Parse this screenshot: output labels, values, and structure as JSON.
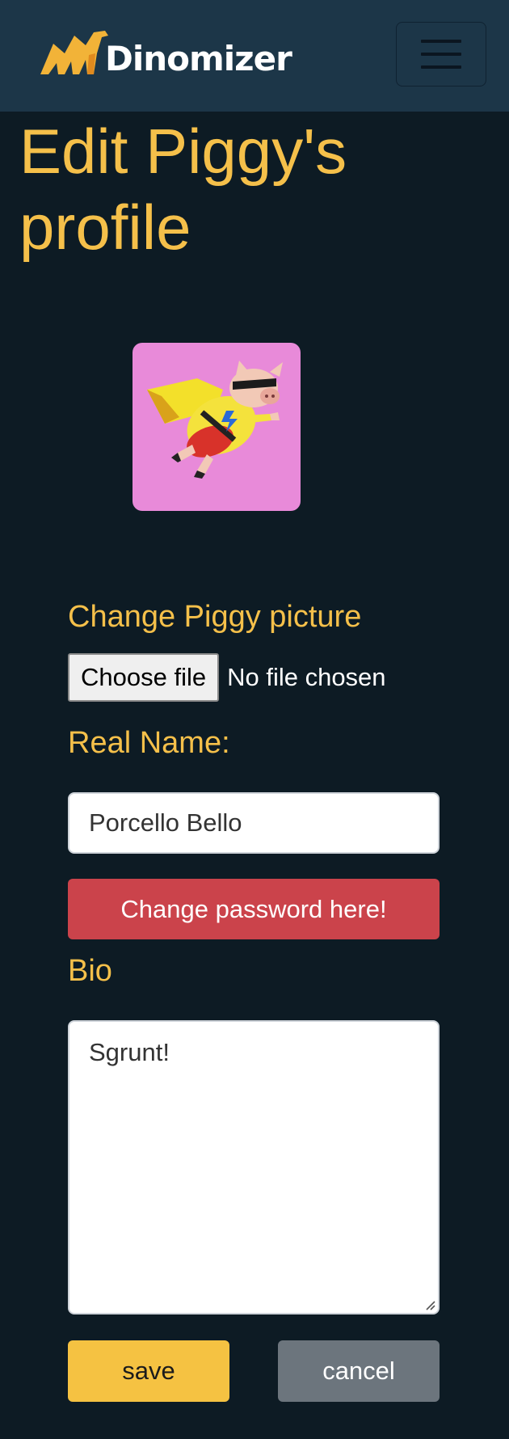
{
  "brand": {
    "name": "Dinomizer",
    "logo_icon": "dinosaur-logo-icon"
  },
  "nav": {
    "toggler_icon": "hamburger-menu-icon"
  },
  "page": {
    "title": "Edit Piggy's profile"
  },
  "avatar": {
    "description_icon": "superhero-pig-image"
  },
  "form": {
    "picture_label": "Change Piggy picture",
    "file_button": "Choose file",
    "file_status": "No file chosen",
    "name_label": "Real Name:",
    "name_value": "Porcello Bello",
    "password_button": "Change password here!",
    "bio_label": "Bio",
    "bio_value": "Sgrunt!",
    "save_label": "save",
    "cancel_label": "cancel"
  },
  "colors": {
    "background": "#0d1b24",
    "navbar": "#1c3648",
    "accent": "#f5c04a",
    "danger": "#cb434b",
    "secondary": "#6c757d"
  }
}
